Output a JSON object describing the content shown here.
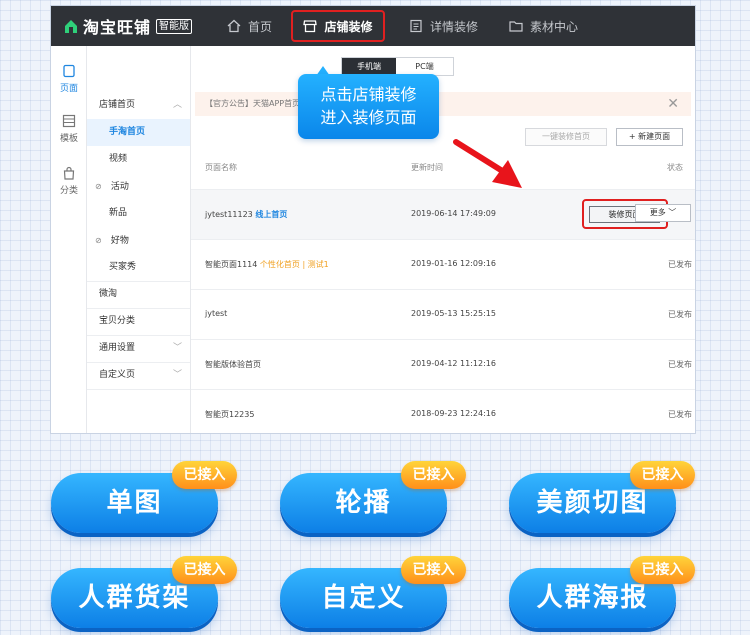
{
  "app": {
    "logo_text": "淘宝旺铺",
    "logo_badge": "智能版",
    "nav": [
      {
        "label": "首页",
        "icon": "home-icon"
      },
      {
        "label": "店铺装修",
        "icon": "store-icon",
        "active": true
      },
      {
        "label": "详情装修",
        "icon": "document-icon"
      },
      {
        "label": "素材中心",
        "icon": "folder-icon"
      }
    ]
  },
  "leftbar": [
    {
      "label": "页面",
      "icon": "page-icon",
      "active": true
    },
    {
      "label": "模板",
      "icon": "template-icon"
    },
    {
      "label": "分类",
      "icon": "bag-icon"
    }
  ],
  "secnav": [
    {
      "label": "店铺首页",
      "chevron": "︿"
    },
    {
      "label": "手淘首页",
      "active": true
    },
    {
      "label": "视频"
    },
    {
      "label": "活动",
      "icon": "hidden-icon"
    },
    {
      "label": "新品"
    },
    {
      "label": "好物",
      "icon": "hidden-icon"
    },
    {
      "label": "买家秀"
    },
    {
      "label": "微淘"
    },
    {
      "label": "宝贝分类"
    },
    {
      "label": "通用设置",
      "chevron": "﹀"
    },
    {
      "label": "自定义页",
      "chevron": "﹀"
    }
  ],
  "main": {
    "device_tabs": [
      "手机端",
      "PC端"
    ],
    "notice": "【官方公告】天猫APP首页",
    "btn_oneclick": "一键装修首页",
    "btn_new": "+ 新建页面",
    "headers": {
      "name": "页面名称",
      "time": "更新时间",
      "status": "状态"
    },
    "rows": [
      {
        "name": "jytest11123",
        "tag": "线上首页",
        "time": "2019-06-14 17:49:09",
        "decorate": "装修页面",
        "more": "更多 ﹀"
      },
      {
        "name": "智能页面1114",
        "tag": "个性化首页 | 测试1",
        "time": "2019-01-16 12:09:16",
        "status": "已发布"
      },
      {
        "name": "jytest",
        "time": "2019-05-13 15:25:15",
        "status": "已发布"
      },
      {
        "name": "智能版体验首页",
        "time": "2019-04-12 11:12:16",
        "status": "已发布"
      },
      {
        "name": "智能页12235",
        "time": "2018-09-23 12:24:16",
        "status": "已发布"
      }
    ],
    "close_glyph": "✕"
  },
  "callout": {
    "line1": "点击店铺装修",
    "line2": "进入装修页面"
  },
  "pills": [
    {
      "label": "单图",
      "badge": "已接入"
    },
    {
      "label": "轮播",
      "badge": "已接入"
    },
    {
      "label": "美颜切图",
      "badge": "已接入"
    },
    {
      "label": "人群货架",
      "badge": "已接入"
    },
    {
      "label": "自定义",
      "badge": "已接入"
    },
    {
      "label": "人群海报",
      "badge": "已接入"
    }
  ],
  "colors": {
    "accent": "#1f86e0",
    "highlight_red": "#e02020",
    "pill_blue": "#0d7fe6",
    "badge_orange": "#ff8f1a"
  }
}
